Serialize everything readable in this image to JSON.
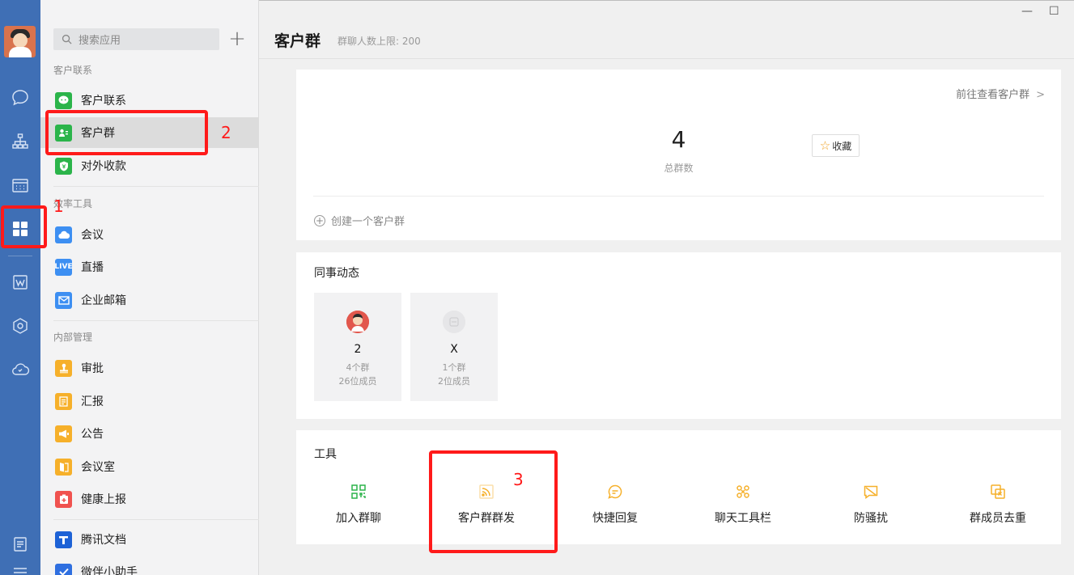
{
  "window": {
    "minimize_label": "—",
    "maximize_label": "☐"
  },
  "sidebar": {
    "search_placeholder": "搜索应用",
    "add_label": "+",
    "groups": [
      {
        "title": "客户联系",
        "items": [
          {
            "label": "客户联系",
            "color": "#2bb44a"
          },
          {
            "label": "客户群",
            "color": "#2bb44a"
          },
          {
            "label": "对外收款",
            "color": "#2bb44a"
          }
        ]
      },
      {
        "title": "效率工具",
        "items": [
          {
            "label": "会议",
            "color": "#3d8ff2"
          },
          {
            "label": "直播",
            "color": "#3d8ff2",
            "badge": "LIVE"
          },
          {
            "label": "企业邮箱",
            "color": "#3d8ff2"
          }
        ]
      },
      {
        "title": "内部管理",
        "items": [
          {
            "label": "审批",
            "color": "#f6b02a"
          },
          {
            "label": "汇报",
            "color": "#f6b02a"
          },
          {
            "label": "公告",
            "color": "#f6b02a"
          },
          {
            "label": "会议室",
            "color": "#f6b02a"
          },
          {
            "label": "健康上报",
            "color": "#f0524f"
          }
        ]
      },
      {
        "title": "",
        "items": [
          {
            "label": "腾讯文档",
            "color": "#1d62d6"
          },
          {
            "label": "微伴小助手",
            "color": "#2f6fe0"
          }
        ]
      }
    ]
  },
  "header": {
    "title": "客户群",
    "subtitle": "群聊人数上限: 200"
  },
  "summary": {
    "goto_label": "前往查看客户群",
    "goto_chevron": ">",
    "total": "4",
    "total_label": "总群数",
    "fav_star": "☆",
    "fav_label": "收藏",
    "create_label": "创建一个客户群",
    "create_plus": "+"
  },
  "colleagues": {
    "title": "同事动态",
    "items": [
      {
        "name": "2",
        "groups": "4个群",
        "members": "26位成员"
      },
      {
        "name": "X",
        "groups": "1个群",
        "members": "2位成员"
      }
    ]
  },
  "tools": {
    "title": "工具",
    "items": [
      {
        "label": "加入群聊",
        "color": "#2bb44a"
      },
      {
        "label": "客户群群发",
        "color": "#f6b02a"
      },
      {
        "label": "快捷回复",
        "color": "#f6b02a"
      },
      {
        "label": "聊天工具栏",
        "color": "#f6b02a"
      },
      {
        "label": "防骚扰",
        "color": "#f6b02a"
      },
      {
        "label": "群成员去重",
        "color": "#f6b02a"
      }
    ]
  },
  "annotations": {
    "one": "1",
    "two": "2",
    "three": "3"
  },
  "colors": {
    "rail": "#3f6fb5",
    "annotation": "#ff1a1a"
  }
}
